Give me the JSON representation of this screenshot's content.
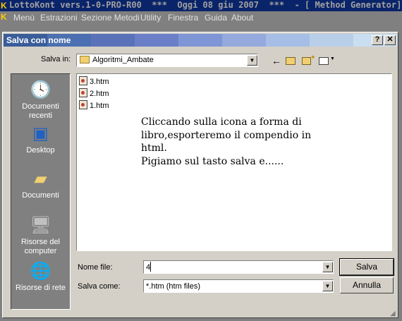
{
  "app": {
    "title": "LottoKont vers.1-0-PRO-R00  ***  Oggi 08 giu 2007  ***  - [ Method Generator]",
    "menu": [
      "Menù",
      "Estrazioni",
      "Sezione Metodi",
      "Utility",
      "Finestra",
      "Guida",
      "About"
    ]
  },
  "dialog": {
    "title": "Salva con nome",
    "help_btn": "?",
    "close_btn": "✕",
    "save_in_label": "Salva in:",
    "save_in_value": "Algoritmi_Ambate",
    "places": [
      "Documenti recenti",
      "Desktop",
      "Documenti",
      "Risorse del computer",
      "Risorse di rete"
    ],
    "files": [
      "3.htm",
      "2.htm",
      "1.htm"
    ],
    "annotation_lines": [
      "Cliccando sulla icona a forma di",
      "libro,esporteremo il compendio in",
      "html.",
      "Pigiamo sul tasto salva e......"
    ],
    "filename_label": "Nome file:",
    "filename_value": "4",
    "savetype_label": "Salva come:",
    "savetype_value": "*.htm (htm files)",
    "save_button": "Salva",
    "cancel_button": "Annulla"
  },
  "colors": {
    "titlebar_segments": [
      "#3a5d9a",
      "#4b6fb0",
      "#5a72b8",
      "#6b7fc8",
      "#7e96d6",
      "#95a9dd",
      "#a6bde6",
      "#b9cfe9",
      "#c9def1"
    ]
  }
}
